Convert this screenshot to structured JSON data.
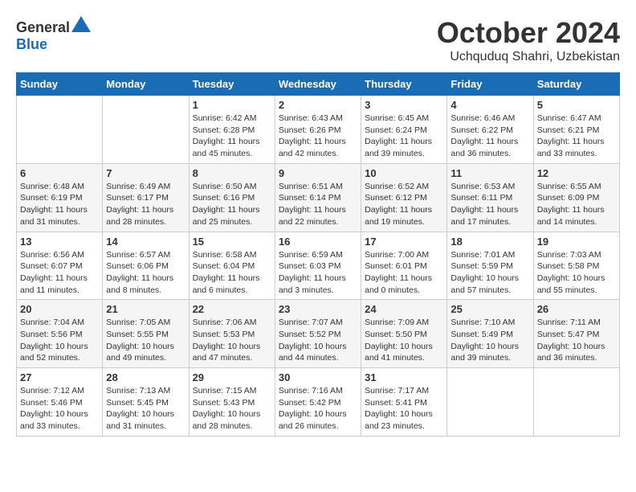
{
  "header": {
    "logo_general": "General",
    "logo_blue": "Blue",
    "month_title": "October 2024",
    "subtitle": "Uchquduq Shahri, Uzbekistan"
  },
  "weekdays": [
    "Sunday",
    "Monday",
    "Tuesday",
    "Wednesday",
    "Thursday",
    "Friday",
    "Saturday"
  ],
  "weeks": [
    [
      {
        "day": "",
        "sunrise": "",
        "sunset": "",
        "daylight": ""
      },
      {
        "day": "",
        "sunrise": "",
        "sunset": "",
        "daylight": ""
      },
      {
        "day": "1",
        "sunrise": "Sunrise: 6:42 AM",
        "sunset": "Sunset: 6:28 PM",
        "daylight": "Daylight: 11 hours and 45 minutes."
      },
      {
        "day": "2",
        "sunrise": "Sunrise: 6:43 AM",
        "sunset": "Sunset: 6:26 PM",
        "daylight": "Daylight: 11 hours and 42 minutes."
      },
      {
        "day": "3",
        "sunrise": "Sunrise: 6:45 AM",
        "sunset": "Sunset: 6:24 PM",
        "daylight": "Daylight: 11 hours and 39 minutes."
      },
      {
        "day": "4",
        "sunrise": "Sunrise: 6:46 AM",
        "sunset": "Sunset: 6:22 PM",
        "daylight": "Daylight: 11 hours and 36 minutes."
      },
      {
        "day": "5",
        "sunrise": "Sunrise: 6:47 AM",
        "sunset": "Sunset: 6:21 PM",
        "daylight": "Daylight: 11 hours and 33 minutes."
      }
    ],
    [
      {
        "day": "6",
        "sunrise": "Sunrise: 6:48 AM",
        "sunset": "Sunset: 6:19 PM",
        "daylight": "Daylight: 11 hours and 31 minutes."
      },
      {
        "day": "7",
        "sunrise": "Sunrise: 6:49 AM",
        "sunset": "Sunset: 6:17 PM",
        "daylight": "Daylight: 11 hours and 28 minutes."
      },
      {
        "day": "8",
        "sunrise": "Sunrise: 6:50 AM",
        "sunset": "Sunset: 6:16 PM",
        "daylight": "Daylight: 11 hours and 25 minutes."
      },
      {
        "day": "9",
        "sunrise": "Sunrise: 6:51 AM",
        "sunset": "Sunset: 6:14 PM",
        "daylight": "Daylight: 11 hours and 22 minutes."
      },
      {
        "day": "10",
        "sunrise": "Sunrise: 6:52 AM",
        "sunset": "Sunset: 6:12 PM",
        "daylight": "Daylight: 11 hours and 19 minutes."
      },
      {
        "day": "11",
        "sunrise": "Sunrise: 6:53 AM",
        "sunset": "Sunset: 6:11 PM",
        "daylight": "Daylight: 11 hours and 17 minutes."
      },
      {
        "day": "12",
        "sunrise": "Sunrise: 6:55 AM",
        "sunset": "Sunset: 6:09 PM",
        "daylight": "Daylight: 11 hours and 14 minutes."
      }
    ],
    [
      {
        "day": "13",
        "sunrise": "Sunrise: 6:56 AM",
        "sunset": "Sunset: 6:07 PM",
        "daylight": "Daylight: 11 hours and 11 minutes."
      },
      {
        "day": "14",
        "sunrise": "Sunrise: 6:57 AM",
        "sunset": "Sunset: 6:06 PM",
        "daylight": "Daylight: 11 hours and 8 minutes."
      },
      {
        "day": "15",
        "sunrise": "Sunrise: 6:58 AM",
        "sunset": "Sunset: 6:04 PM",
        "daylight": "Daylight: 11 hours and 6 minutes."
      },
      {
        "day": "16",
        "sunrise": "Sunrise: 6:59 AM",
        "sunset": "Sunset: 6:03 PM",
        "daylight": "Daylight: 11 hours and 3 minutes."
      },
      {
        "day": "17",
        "sunrise": "Sunrise: 7:00 AM",
        "sunset": "Sunset: 6:01 PM",
        "daylight": "Daylight: 11 hours and 0 minutes."
      },
      {
        "day": "18",
        "sunrise": "Sunrise: 7:01 AM",
        "sunset": "Sunset: 5:59 PM",
        "daylight": "Daylight: 10 hours and 57 minutes."
      },
      {
        "day": "19",
        "sunrise": "Sunrise: 7:03 AM",
        "sunset": "Sunset: 5:58 PM",
        "daylight": "Daylight: 10 hours and 55 minutes."
      }
    ],
    [
      {
        "day": "20",
        "sunrise": "Sunrise: 7:04 AM",
        "sunset": "Sunset: 5:56 PM",
        "daylight": "Daylight: 10 hours and 52 minutes."
      },
      {
        "day": "21",
        "sunrise": "Sunrise: 7:05 AM",
        "sunset": "Sunset: 5:55 PM",
        "daylight": "Daylight: 10 hours and 49 minutes."
      },
      {
        "day": "22",
        "sunrise": "Sunrise: 7:06 AM",
        "sunset": "Sunset: 5:53 PM",
        "daylight": "Daylight: 10 hours and 47 minutes."
      },
      {
        "day": "23",
        "sunrise": "Sunrise: 7:07 AM",
        "sunset": "Sunset: 5:52 PM",
        "daylight": "Daylight: 10 hours and 44 minutes."
      },
      {
        "day": "24",
        "sunrise": "Sunrise: 7:09 AM",
        "sunset": "Sunset: 5:50 PM",
        "daylight": "Daylight: 10 hours and 41 minutes."
      },
      {
        "day": "25",
        "sunrise": "Sunrise: 7:10 AM",
        "sunset": "Sunset: 5:49 PM",
        "daylight": "Daylight: 10 hours and 39 minutes."
      },
      {
        "day": "26",
        "sunrise": "Sunrise: 7:11 AM",
        "sunset": "Sunset: 5:47 PM",
        "daylight": "Daylight: 10 hours and 36 minutes."
      }
    ],
    [
      {
        "day": "27",
        "sunrise": "Sunrise: 7:12 AM",
        "sunset": "Sunset: 5:46 PM",
        "daylight": "Daylight: 10 hours and 33 minutes."
      },
      {
        "day": "28",
        "sunrise": "Sunrise: 7:13 AM",
        "sunset": "Sunset: 5:45 PM",
        "daylight": "Daylight: 10 hours and 31 minutes."
      },
      {
        "day": "29",
        "sunrise": "Sunrise: 7:15 AM",
        "sunset": "Sunset: 5:43 PM",
        "daylight": "Daylight: 10 hours and 28 minutes."
      },
      {
        "day": "30",
        "sunrise": "Sunrise: 7:16 AM",
        "sunset": "Sunset: 5:42 PM",
        "daylight": "Daylight: 10 hours and 26 minutes."
      },
      {
        "day": "31",
        "sunrise": "Sunrise: 7:17 AM",
        "sunset": "Sunset: 5:41 PM",
        "daylight": "Daylight: 10 hours and 23 minutes."
      },
      {
        "day": "",
        "sunrise": "",
        "sunset": "",
        "daylight": ""
      },
      {
        "day": "",
        "sunrise": "",
        "sunset": "",
        "daylight": ""
      }
    ]
  ]
}
